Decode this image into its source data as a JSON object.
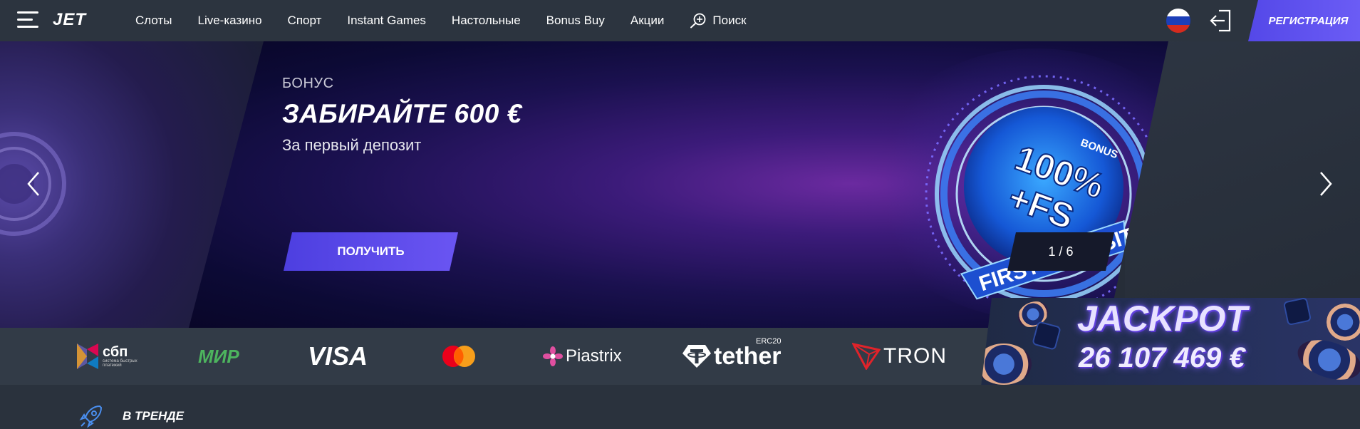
{
  "header": {
    "logo": "JET",
    "nav": [
      "Слоты",
      "Live-казино",
      "Спорт",
      "Instant Games",
      "Настольные",
      "Bonus Buy",
      "Акции"
    ],
    "search_label": "Поиск",
    "register_label": "РЕГИСТРАЦИЯ"
  },
  "hero": {
    "kicker": "БОНУС",
    "title": "ЗАБИРАЙТЕ 600 €",
    "subtitle": "За первый депозит",
    "cta_label": "ПОЛУЧИТЬ",
    "slide_counter": "1 / 6",
    "badge_top": "BONUS",
    "badge_main": "100%",
    "badge_sub": "+FS",
    "badge_ribbon": "FIRST DEPOSIT"
  },
  "payments": {
    "items": [
      {
        "name": "sbp",
        "label": "сбп",
        "caption": "система быстрых платежей"
      },
      {
        "name": "mir",
        "label": "МИР"
      },
      {
        "name": "visa",
        "label": "VISA"
      },
      {
        "name": "mastercard",
        "label": ""
      },
      {
        "name": "piastrix",
        "label": "Piastrix"
      },
      {
        "name": "tether",
        "label": "tether",
        "caption": "ERC20"
      },
      {
        "name": "tron",
        "label": "TRON"
      }
    ]
  },
  "jackpot": {
    "title": "JACKPOT",
    "amount": "26 107 469 €"
  },
  "trending": {
    "title": "В ТРЕНДЕ"
  },
  "colors": {
    "accent": "#5a4aec",
    "header_bg": "#2c343f",
    "payments_bg": "#323b47"
  }
}
